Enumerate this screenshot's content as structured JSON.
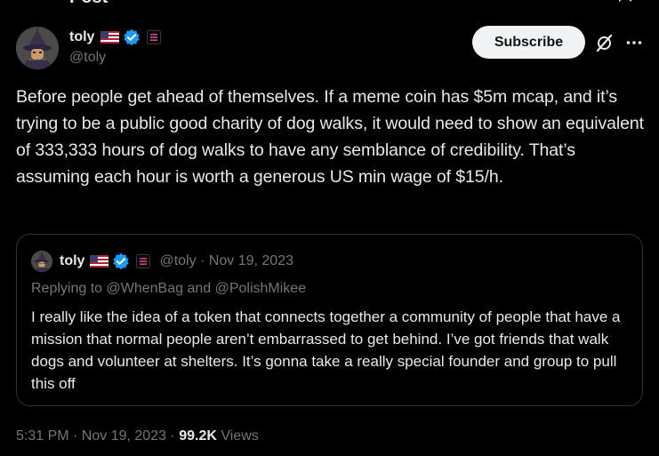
{
  "topbar": {
    "title": "Post",
    "corner_icon": "bookmark-icon"
  },
  "author": {
    "display_name": "toly",
    "handle": "@toly",
    "flag": "us-flag-icon",
    "verified_color": "#1d9bf0",
    "affiliate_color": "#e2457b"
  },
  "actions": {
    "subscribe_label": "Subscribe",
    "grok_icon": "grok-icon",
    "more_icon": "more-icon"
  },
  "tweet": {
    "text": "Before people get ahead of themselves. If a meme coin has $5m mcap, and it’s trying to be a public good charity of dog walks, it would need to show an equivalent of 333,333 hours of dog walks to have any semblance of credibility. That’s assuming each hour is worth a generous US min wage of $15/h."
  },
  "quote": {
    "display_name": "toly",
    "meta": "@toly · Nov 19, 2023",
    "reply_to": "Replying to @WhenBag and @PolishMikee",
    "text": "I really like the idea of a token that connects together a community of people that have a mission that normal people aren’t embarrassed to get behind.  I’ve got friends that walk dogs and volunteer at shelters. It’s gonna take a really special founder and group to pull this off"
  },
  "footer": {
    "timestamp": "5:31 PM · Nov 19, 2023 · ",
    "views_count": "99.2K",
    "views_label": " Views"
  },
  "colors": {
    "background": "#000000",
    "text": "#e7e9ea",
    "secondary": "#71767b",
    "border": "#2f3336",
    "button_bg": "#eff3f4"
  }
}
